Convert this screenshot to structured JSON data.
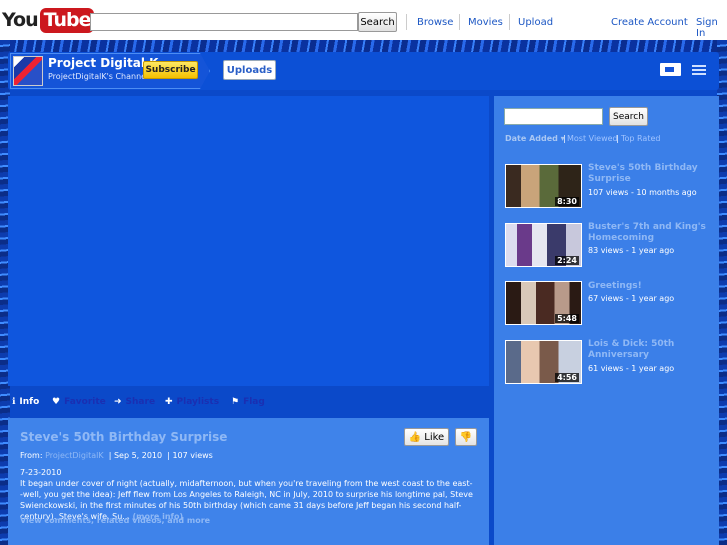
{
  "masthead": {
    "logo_you": "You",
    "logo_tube": "Tube",
    "search_button": "Search",
    "nav": [
      "Browse",
      "Movies",
      "Upload"
    ],
    "create_account": "Create Account",
    "sign_in": "Sign In"
  },
  "channel": {
    "name": "Project Digital K",
    "subtitle": "ProjectDigitalK's Channel",
    "subscribe": "Subscribe",
    "uploads": "Uploads"
  },
  "tabs": [
    {
      "icon": "ℹ",
      "label": "Info"
    },
    {
      "icon": "♥",
      "label": "Favorite"
    },
    {
      "icon": "➜",
      "label": "Share"
    },
    {
      "icon": "✚",
      "label": "Playlists"
    },
    {
      "icon": "⚑",
      "label": "Flag"
    }
  ],
  "video": {
    "title": "Steve's 50th Birthday Surprise",
    "like": "Like",
    "from_label": "From:",
    "author": "ProjectDigitalK",
    "date": "Sep 5, 2010",
    "views": "107 views",
    "desc_date": "7-23-2010",
    "description": "It began under cover of night (actually, midafternoon, but when you're traveling from the west coast to the east--well, you get the idea): Jeff flew from Los Angeles to Raleigh, NC in July, 2010 to surprise his longtime pal, Steve Swienckowski, in the first minutes of his 50th birthday (which came 31 days before Jeff began his second half-century). Steve's wife, Su...",
    "more": "(more info)",
    "view_comments": "View comments, related videos, and more"
  },
  "sidebar": {
    "search_button": "Search",
    "sort": [
      "Date Added",
      "Most Viewed",
      "Top Rated"
    ],
    "items": [
      {
        "title": "Steve's 50th Birthday Surprise",
        "meta": "107 views - 10 months ago",
        "duration": "8:30"
      },
      {
        "title": "Buster's 7th and King's Homecoming",
        "meta": "83 views - 1 year ago",
        "duration": "2:24"
      },
      {
        "title": "Greetings!",
        "meta": "67 views - 1 year ago",
        "duration": "5:48"
      },
      {
        "title": "Lois & Dick: 50th Anniversary",
        "meta": "61 views - 1 year ago",
        "duration": "4:56"
      }
    ]
  },
  "colors": {
    "background": "#0b49c9",
    "panel": "#3f83ea",
    "link_light": "#8fb8f5",
    "subscribe": "#f3c000",
    "brand_red": "#cc181e"
  }
}
